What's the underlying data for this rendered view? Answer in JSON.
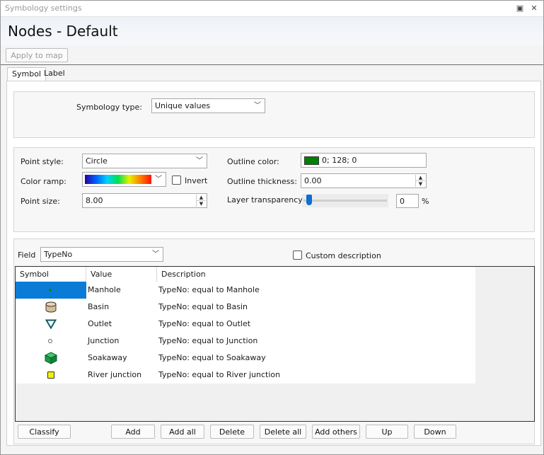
{
  "window": {
    "title": "Symbology settings",
    "pin_icon": "restore-icon",
    "close_icon": "close-icon"
  },
  "header": {
    "title": "Nodes - Default"
  },
  "toolbar": {
    "apply_label": "Apply to map"
  },
  "tabs": [
    {
      "label": "Symbol"
    },
    {
      "label": "Label"
    }
  ],
  "symbology": {
    "type_label": "Symbology type:",
    "type_value": "Unique values"
  },
  "style": {
    "point_style_label": "Point style:",
    "point_style_value": "Circle",
    "color_ramp_label": "Color ramp:",
    "invert_label": "Invert",
    "point_size_label": "Point size:",
    "point_size_value": "8.00",
    "outline_color_label": "Outline color:",
    "outline_color_value": "0; 128; 0",
    "outline_color_hex": "#008000",
    "outline_thickness_label": "Outline thickness:",
    "outline_thickness_value": "0.00",
    "transparency_label": "Layer transparency:",
    "transparency_value": "0",
    "transparency_unit": "%"
  },
  "field": {
    "label": "Field",
    "value": "TypeNo",
    "custom_desc_label": "Custom description"
  },
  "table": {
    "headers": {
      "symbol": "Symbol",
      "value": "Value",
      "description": "Description"
    },
    "rows": [
      {
        "value": "Manhole",
        "description": "TypeNo: equal to Manhole",
        "symbol": "small-green-dot-icon"
      },
      {
        "value": "Basin",
        "description": "TypeNo: equal to Basin",
        "symbol": "basin-cylinder-icon"
      },
      {
        "value": "Outlet",
        "description": "TypeNo: equal to Outlet",
        "symbol": "outlet-triangle-icon"
      },
      {
        "value": "Junction",
        "description": "TypeNo: equal to Junction",
        "symbol": "junction-circle-icon"
      },
      {
        "value": "Soakaway",
        "description": "TypeNo: equal to Soakaway",
        "symbol": "soakaway-cube-icon"
      },
      {
        "value": "River junction",
        "description": "TypeNo: equal to River junction",
        "symbol": "river-junction-square-icon"
      }
    ]
  },
  "buttons": {
    "classify": "Classify",
    "add": "Add",
    "add_all": "Add all",
    "delete": "Delete",
    "delete_all": "Delete all",
    "add_others": "Add others",
    "up": "Up",
    "down": "Down"
  }
}
